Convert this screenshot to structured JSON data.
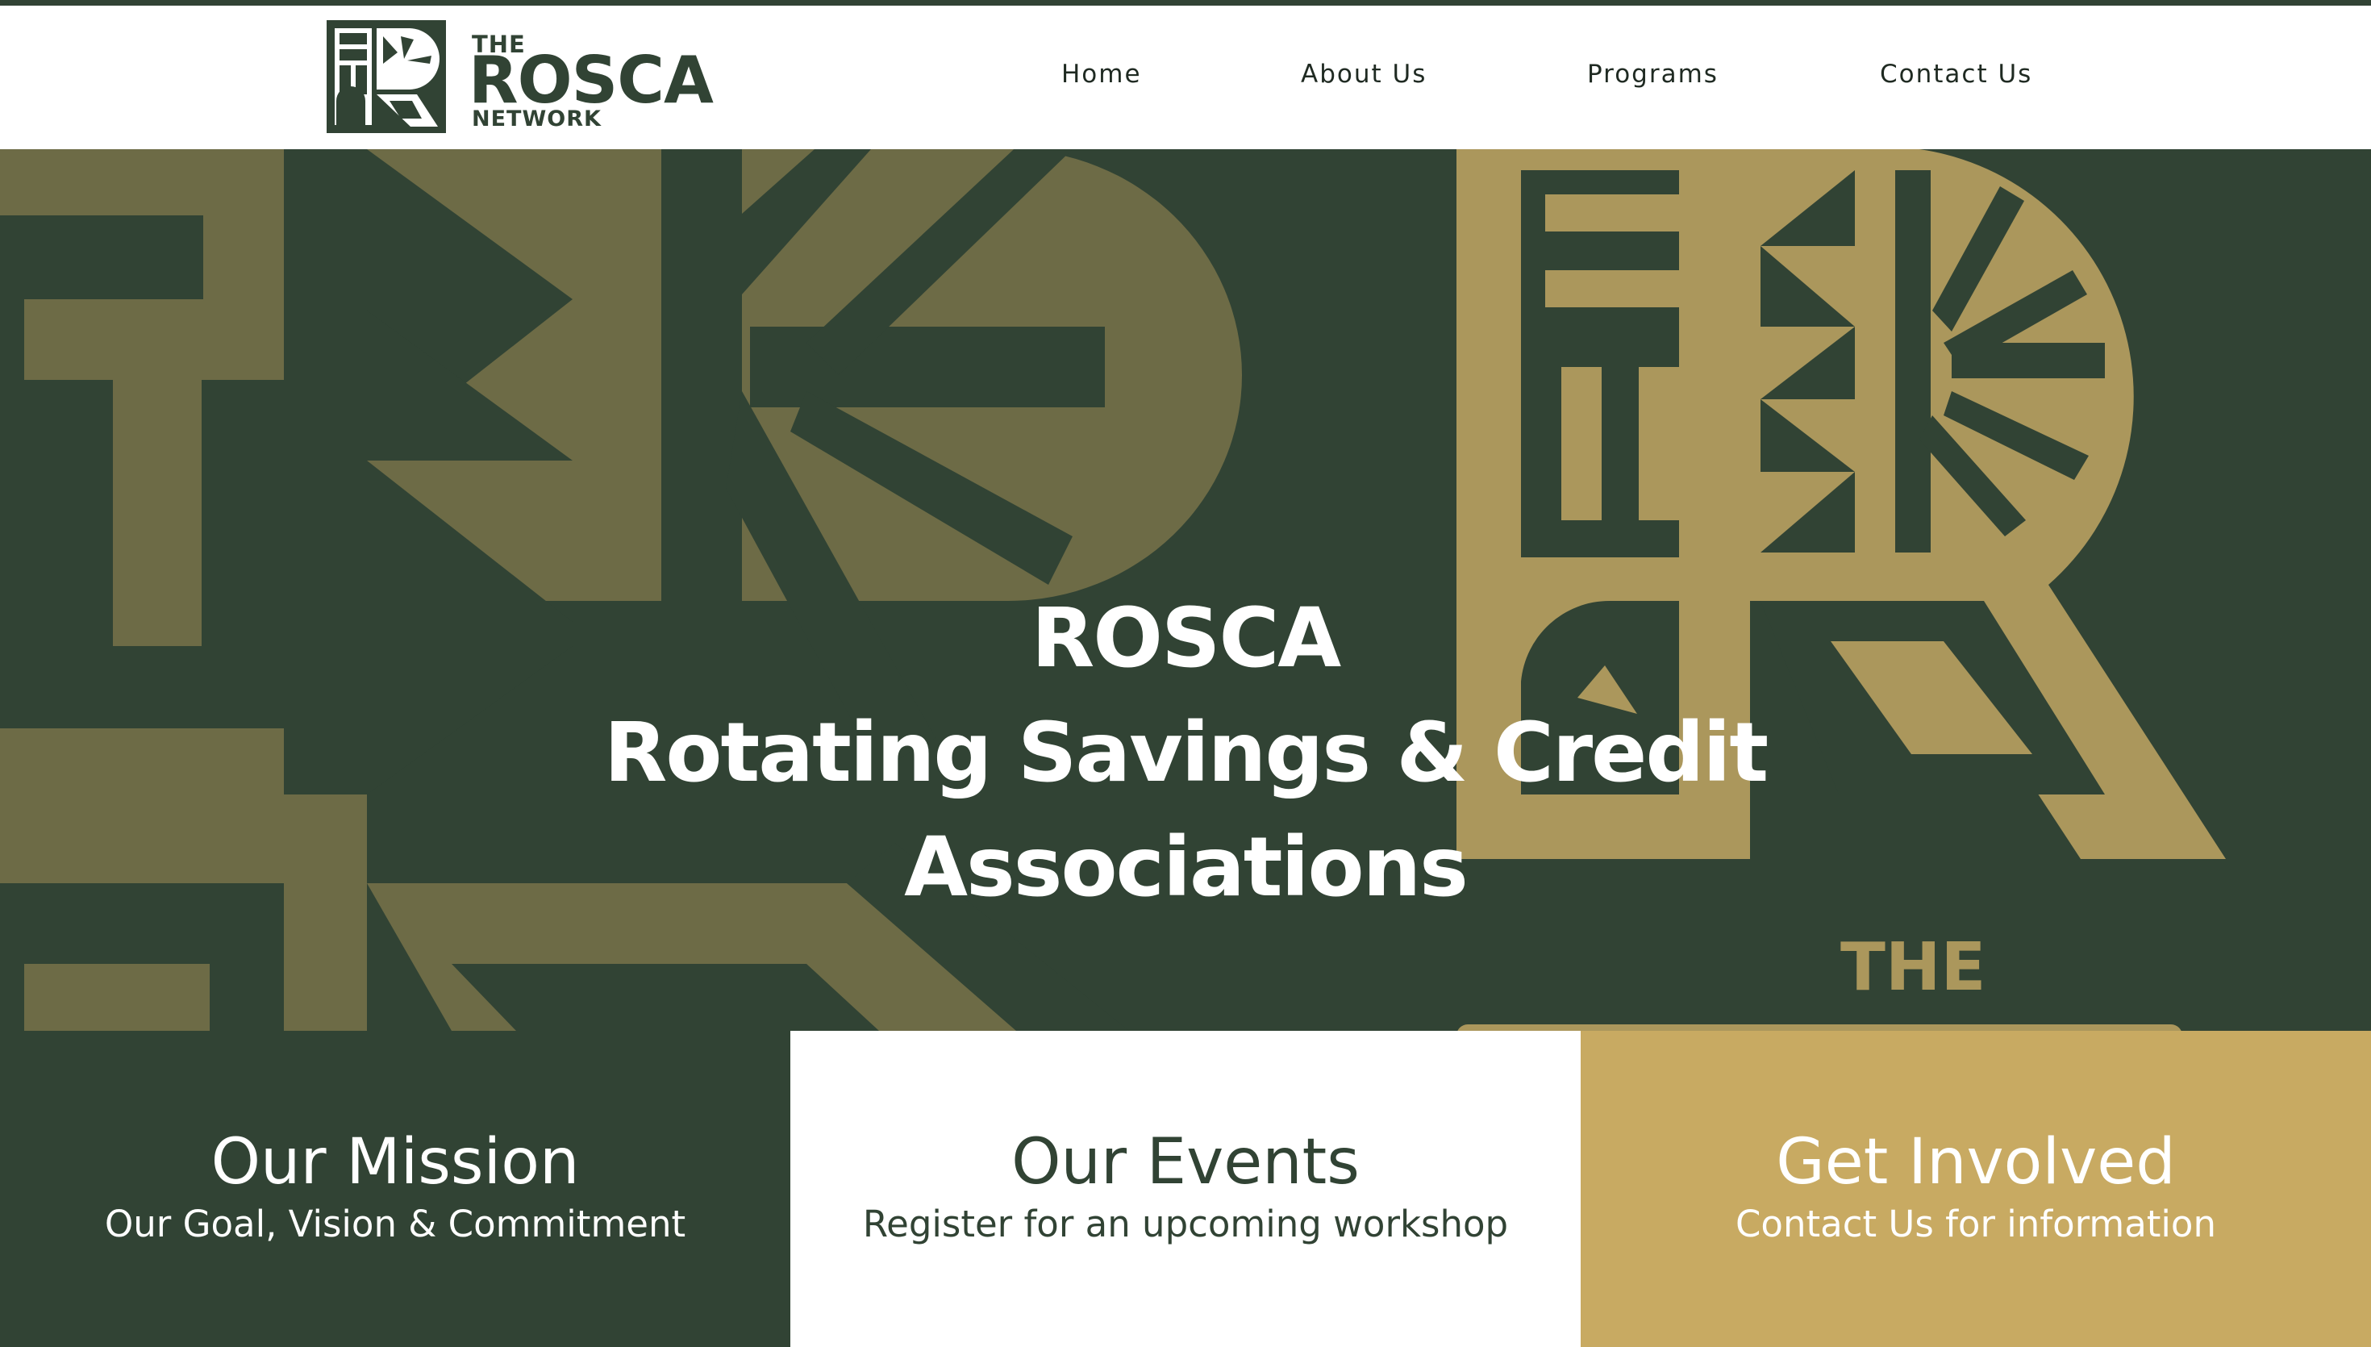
{
  "logo": {
    "the": "THE",
    "rosca": "ROSCA",
    "network": "NETWORK"
  },
  "nav": {
    "items": [
      {
        "label": "Home"
      },
      {
        "label": "About Us"
      },
      {
        "label": "Programs"
      },
      {
        "label": "Contact Us"
      }
    ]
  },
  "hero": {
    "line1": "ROSCA",
    "line2": "Rotating Savings & Credit",
    "line3": "Associations",
    "art_text": "THE"
  },
  "cards": [
    {
      "title": "Our Mission",
      "subtitle": "Our Goal, Vision & Commitment"
    },
    {
      "title": "Our Events",
      "subtitle": "Register for an upcoming workshop"
    },
    {
      "title": "Get Involved",
      "subtitle": "Contact Us for information"
    }
  ],
  "colors": {
    "dark_green": "#314334",
    "olive": "#6d6b46",
    "gold": "#ab975c",
    "card_gold": "#c8aa62",
    "white": "#ffffff"
  }
}
